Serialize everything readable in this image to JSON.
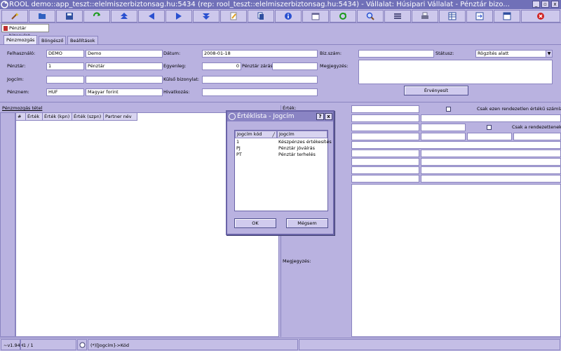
{
  "window": {
    "title": "ROOL demo::app_teszt::elelmiszerbiztonsag.hu:5434 (rep: rool_teszt::elelmiszerbiztonsag.hu:5434) - Vállalat: Húsipari Vállalat - Pénztár bizo...",
    "controls": [
      "_",
      "▫",
      "x"
    ]
  },
  "toolbar": {
    "icons": [
      "wand-icon",
      "open-folder-icon",
      "save-icon",
      "refresh-icon",
      "first-record-icon",
      "previous-record-icon",
      "next-record-icon",
      "last-record-icon",
      "edit-pencil-icon",
      "copy-icon",
      "info-icon",
      "calendar-icon",
      "sync-icon",
      "search-icon",
      "list-icon",
      "print-icon",
      "table-icon",
      "export-icon",
      "window-icon",
      "close-circle-icon"
    ],
    "colors": {
      "green": "#1a9a1a",
      "blue": "#2a50d0",
      "red": "#d02020",
      "yellow": "#e0c020"
    }
  },
  "doc_tab": {
    "label": "Pénztár bizonylat"
  },
  "tabs": [
    {
      "label": "Pénzmozgás"
    },
    {
      "label": "Böngésző"
    },
    {
      "label": "Beállítások"
    }
  ],
  "form": {
    "felhasznalo": {
      "label": "Felhasználó:",
      "code": "DEMO",
      "name": "Demo"
    },
    "penztar": {
      "label": "Pénztár:",
      "code": "1",
      "name": "Pénztár"
    },
    "jogcim": {
      "label": "Jogcím:",
      "code": "",
      "name": ""
    },
    "penznem": {
      "label": "Pénznem:",
      "code": "HUF",
      "name": "Magyar forint"
    },
    "datum": {
      "label": "Dátum:",
      "value": "2008-01-18"
    },
    "egyenleg": {
      "label": "Egyenleg:",
      "value": "0"
    },
    "penztar_zaras": {
      "label": "Pénztár zárás:",
      "value": ""
    },
    "kulso_bizonylat": {
      "label": "Külső bizonylat:",
      "value": ""
    },
    "hivatkozas": {
      "label": "Hivatkozás:",
      "value": ""
    },
    "biz_szam": {
      "label": "Biz.szám:",
      "value": ""
    },
    "megjegyzes": {
      "label": "Megjegyzés:",
      "value": ""
    },
    "statusz": {
      "label": "Státusz:",
      "value": "Rögzítés alatt"
    },
    "ervenyesit": "Érvényesít"
  },
  "movement": {
    "title": "Pénzmozgás tétel",
    "columns": [
      "#",
      "Érték",
      "Érték (kpn)",
      "Érték (szpn)",
      "Partner név"
    ]
  },
  "right": {
    "ertek_label": "Érték:",
    "chk1_label": "Csak ezen rendezetlen értékű számlák?",
    "chk2_label": "Csak a rendezettenek?",
    "megjegyzes_label": "Megjegyzés:"
  },
  "dialog": {
    "title": "Értéklista - Jogcím",
    "help": "?",
    "close": "x",
    "columns": [
      "Jogcím kód",
      "Jogcím"
    ],
    "rows": [
      {
        "code": "1",
        "name": "Készpénzes értékesítés"
      },
      {
        "code": "PJ",
        "name": "Pénztár jóváírás"
      },
      {
        "code": "PT",
        "name": "Pénztár terhelés"
      }
    ],
    "ok": "OK",
    "cancel": "Mégsem"
  },
  "statusbar": {
    "version": "~v1.94H",
    "position": "1 / 1",
    "hint": "(*)[Jogcím]->Kód"
  }
}
